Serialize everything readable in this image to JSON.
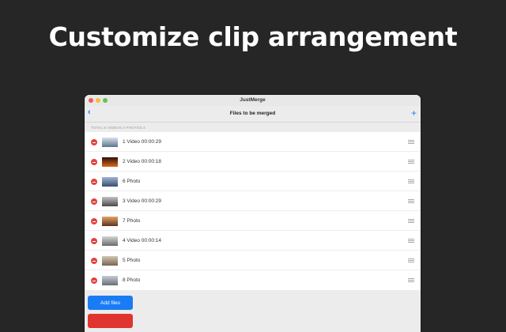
{
  "headline": "Customize clip arrangement",
  "window": {
    "app_title": "JustMerge",
    "nav_title": "Files to be merged",
    "summary": "TOTAL:8  VIDEOS:4  PHOTOS:4"
  },
  "items": [
    {
      "label": "1 Video 00:00:29",
      "thumb": "mountain-thumbnail",
      "colors": [
        "#d7e3ef",
        "#5f7387"
      ]
    },
    {
      "label": "2 Video 00:00:18",
      "thumb": "fire-thumbnail",
      "colors": [
        "#2b1105",
        "#d86a1f"
      ]
    },
    {
      "label": "6 Photo",
      "thumb": "city-thumbnail",
      "colors": [
        "#9fb5d6",
        "#3c4d6e"
      ]
    },
    {
      "label": "3 Video 00:00:29",
      "thumb": "building-thumbnail",
      "colors": [
        "#c3c3c3",
        "#4a4a4a"
      ]
    },
    {
      "label": "7 Photo",
      "thumb": "sunset-thumbnail",
      "colors": [
        "#e5a266",
        "#5a3422"
      ]
    },
    {
      "label": "4 Video 00:00:14",
      "thumb": "harbor-thumbnail",
      "colors": [
        "#d5d5d5",
        "#6b6b6b"
      ]
    },
    {
      "label": "5 Photo",
      "thumb": "landscape-thumbnail",
      "colors": [
        "#d2c7b2",
        "#7a6450"
      ]
    },
    {
      "label": "8 Photo",
      "thumb": "street-thumbnail",
      "colors": [
        "#c8ccd2",
        "#666e79"
      ]
    }
  ],
  "footer": {
    "add_label": "Add files"
  },
  "colors": {
    "accent": "#1a7cf5",
    "delete": "#e0443e",
    "background": "#262626"
  }
}
